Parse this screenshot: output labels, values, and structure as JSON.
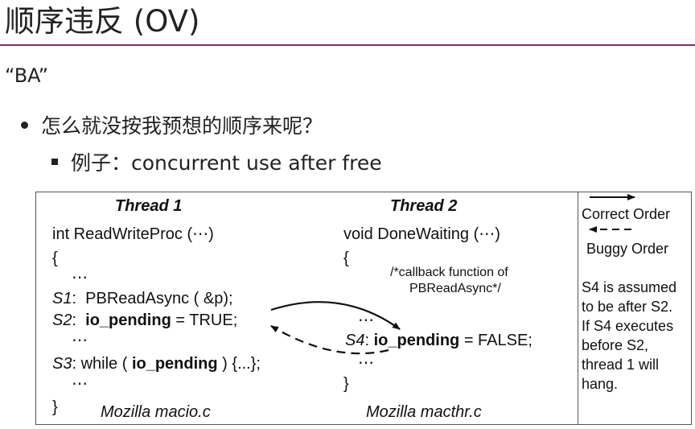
{
  "slide": {
    "title": "顺序违反 (OV)",
    "subtitle": "“BA”",
    "bullet1": "怎么就没按我预想的顺序来呢？",
    "bullet2": "例子：concurrent use after free"
  },
  "figure": {
    "thread1": {
      "header": "Thread 1",
      "func": "int ReadWriteProc (⋯)",
      "open": "{",
      "ell1": "⋯",
      "s1_label": "S1",
      "s1_text": ":  PBReadAsync ( &p);",
      "s2_label": "S2",
      "s2_sep": ":  ",
      "s2_var": "io_pending",
      "s2_rest": " = TRUE;",
      "ell2": "⋯",
      "s3_label": "S3",
      "s3_pre": ": while ( ",
      "s3_var": "io_pending",
      "s3_rest": " ) {...};",
      "ell3": "⋯",
      "close": "}",
      "file": "Mozilla macio.c"
    },
    "thread2": {
      "header": "Thread 2",
      "func": "void DoneWaiting (⋯)",
      "open": "{",
      "comment1": "/*callback function of",
      "comment2": "PBReadAsync*/",
      "ell1": "⋯",
      "s4_label": "S4",
      "s4_sep": ": ",
      "s4_var": "io_pending",
      "s4_rest": " = FALSE;",
      "ell2": "⋯",
      "close": "}",
      "file": "Mozilla macthr.c"
    },
    "legend": {
      "correct": "Correct Order",
      "buggy": "Buggy Order",
      "note": "S4 is assumed\nto be after S2.\nIf S4 executes\nbefore S2,\nthread 1 will\nhang."
    }
  }
}
